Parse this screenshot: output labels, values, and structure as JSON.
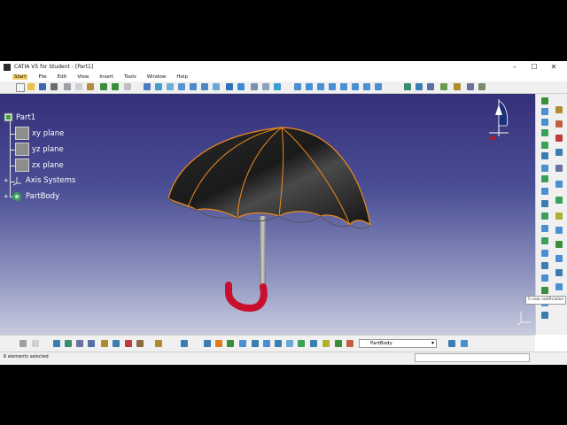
{
  "window": {
    "title": "CATIA V5 for Student - [Part1]",
    "controls": [
      "–",
      "☐",
      "✕"
    ]
  },
  "menu": [
    "Start",
    "File",
    "Edit",
    "View",
    "Insert",
    "Tools",
    "Window",
    "Help"
  ],
  "tree": {
    "root": "Part1",
    "items": [
      "xy plane",
      "yz plane",
      "zx plane",
      "Axis Systems",
      "PartBody"
    ]
  },
  "bottom_toolbar": {
    "body_select": "PartBody"
  },
  "status": {
    "text": "6 elements selected",
    "notification": "5 new notification"
  },
  "colors": {
    "canopy": "#1c1c1c",
    "highlight_edge": "#f08a1c",
    "handle_red": "#c8102e",
    "shaft_gray": "#9e9e9e"
  }
}
